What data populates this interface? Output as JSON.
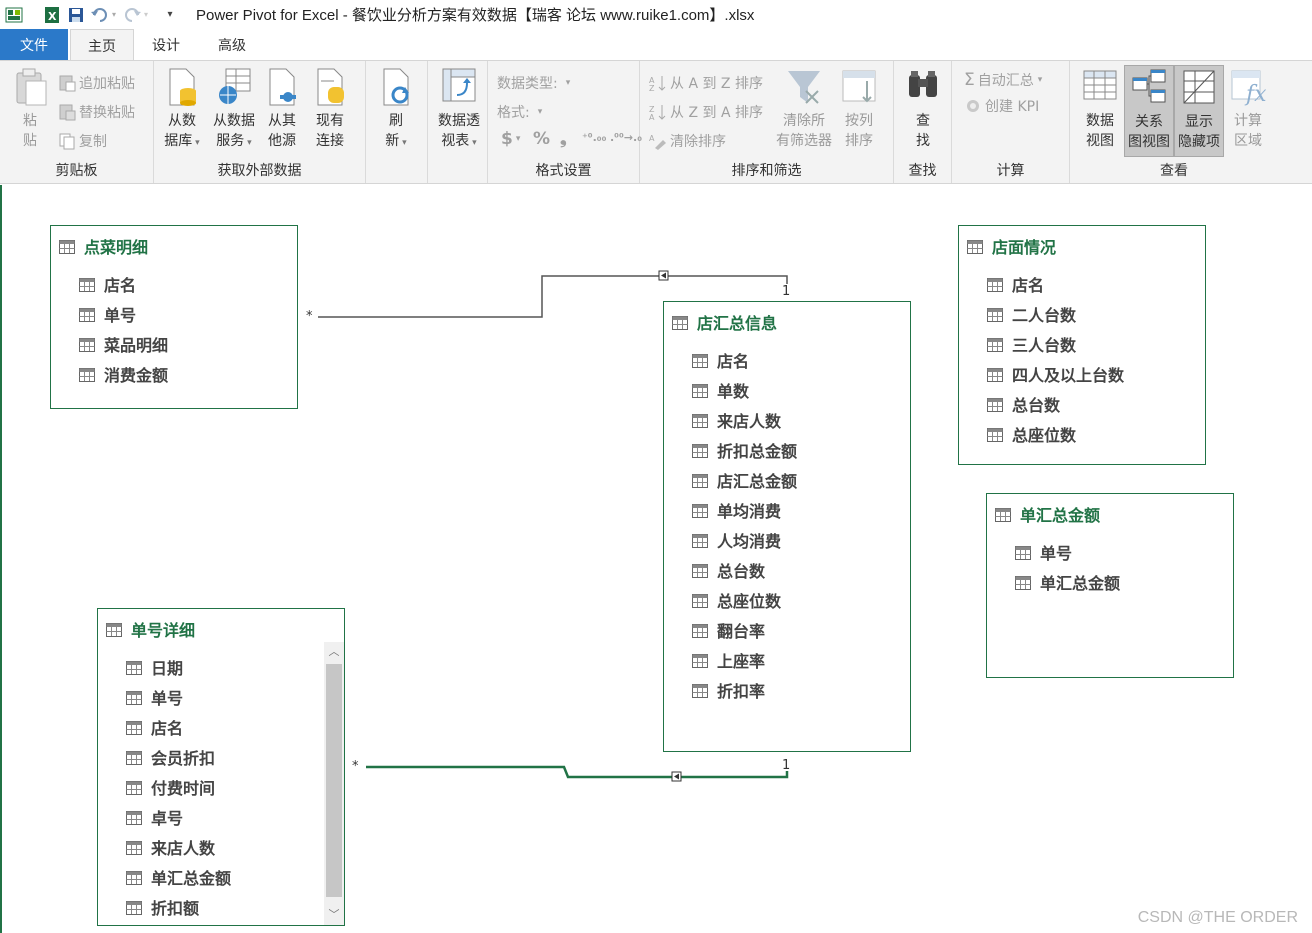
{
  "window": {
    "title": "Power Pivot for Excel - 餐饮业分析方案有效数据【瑞客 论坛 www.ruike1.com】.xlsx"
  },
  "tabs": {
    "file": "文件",
    "home": "主页",
    "design": "设计",
    "advanced": "高级"
  },
  "ribbon": {
    "clipboard": {
      "label": "剪贴板",
      "paste": [
        "粘",
        "贴"
      ],
      "paste_append": "追加粘贴",
      "paste_replace": "替换粘贴",
      "copy": "复制"
    },
    "external": {
      "label": "获取外部数据",
      "from_db": [
        "从数",
        "据库"
      ],
      "from_service": [
        "从数据",
        "服务"
      ],
      "from_other": [
        "从其",
        "他源"
      ],
      "existing": [
        "现有",
        "连接"
      ]
    },
    "refresh": [
      "刷",
      "新"
    ],
    "pivot": [
      "数据透",
      "视表"
    ],
    "format": {
      "label": "格式设置",
      "data_type": "数据类型:",
      "format": "格式:",
      "symbols": [
        "$",
        "%",
        "❟",
        "⁺⁰.₀₀",
        ".⁰⁰→.₀"
      ]
    },
    "sort": {
      "label": "排序和筛选",
      "a_to_z": "从 A 到 Z 排序",
      "z_to_a": "从 Z 到 A 排序",
      "clear_sort": "清除排序",
      "clear_filters": [
        "清除所",
        "有筛选器"
      ],
      "sort_by_col": [
        "按列",
        "排序"
      ]
    },
    "find": {
      "label": "查找",
      "btn": [
        "查",
        "找"
      ]
    },
    "calc": {
      "label": "计算",
      "autosum": "自动汇总",
      "kpi": "创建 KPI"
    },
    "view": {
      "label": "查看",
      "data_view": [
        "数据",
        "视图"
      ],
      "diagram_view": [
        "关系",
        "图视图"
      ],
      "show_hidden": [
        "显示",
        "隐藏项"
      ],
      "calc_area": [
        "计算",
        "区域"
      ]
    }
  },
  "tables": {
    "dish_detail": {
      "name": "点菜明细",
      "fields": [
        "店名",
        "单号",
        "菜品明细",
        "消费金额"
      ]
    },
    "store_info": {
      "name": "店面情况",
      "fields": [
        "店名",
        "二人台数",
        "三人台数",
        "四人及以上台数",
        "总台数",
        "总座位数"
      ]
    },
    "store_summary": {
      "name": "店汇总信息",
      "fields": [
        "店名",
        "单数",
        "来店人数",
        "折扣总金额",
        "店汇总金额",
        "单均消费",
        "人均消费",
        "总台数",
        "总座位数",
        "翻台率",
        "上座率",
        "折扣率"
      ]
    },
    "order_total": {
      "name": "单汇总金额",
      "fields": [
        "单号",
        "单汇总金额"
      ]
    },
    "order_detail": {
      "name": "单号详细",
      "fields": [
        "日期",
        "单号",
        "店名",
        "会员折扣",
        "付费时间",
        "卓号",
        "来店人数",
        "单汇总金额",
        "折扣额"
      ]
    }
  },
  "relationships": {
    "many": "*",
    "one": "1"
  },
  "watermark": "CSDN @THE ORDER"
}
